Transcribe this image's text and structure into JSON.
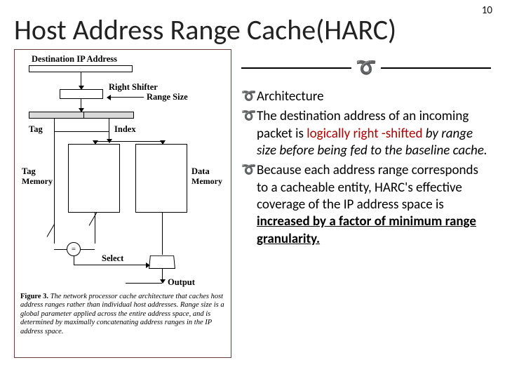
{
  "page_number": "10",
  "title": "Host Address Range Cache(HARC)",
  "bullets": [
    {
      "plain": "Architecture"
    },
    {
      "pre": "The destination address of an incoming packet is ",
      "red": "logically right -shifted",
      "post_ital": " by range size before being fed to the baseline cache."
    },
    {
      "pre2": "Because each address range corresponds to a cacheable entity, HARC's effective coverage of the IP address space is ",
      "ul": "increased by a factor of minimum range granularity."
    }
  ],
  "figure": {
    "top_label": "Destination IP Address",
    "right_shifter": "Right Shifter",
    "range_size": "Range Size",
    "tag": "Tag",
    "index": "Index",
    "tag_memory": "Tag Memory",
    "data_memory": "Data Memory",
    "select": "Select",
    "equals": "=",
    "output": "Output",
    "caption_label": "Figure 3.",
    "caption_text": " The network processor cache architecture that caches host address ranges rather than individual host addresses. Range size is a global parameter applied across the entire address space, and is determined by maximally concatenating address ranges in the IP address space."
  }
}
